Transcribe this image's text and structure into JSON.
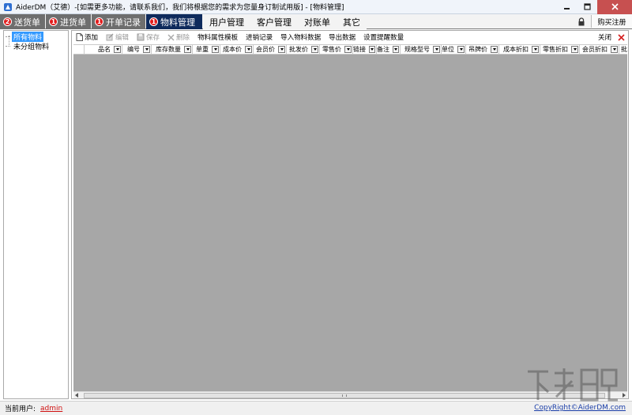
{
  "window": {
    "title": "AiderDM（艾德）-[如需更多功能，请联系我们，我们将根据您的需求为您量身订制试用版] - [物料管理]"
  },
  "tabs": [
    {
      "label": "送货单",
      "badge": "2",
      "style": "dark"
    },
    {
      "label": "进货单",
      "badge": "1",
      "style": "dark"
    },
    {
      "label": "开单记录",
      "badge": "1",
      "style": "dark"
    },
    {
      "label": "物料管理",
      "badge": "1",
      "style": "active"
    },
    {
      "label": "用户管理",
      "style": "plain"
    },
    {
      "label": "客户管理",
      "style": "plain"
    },
    {
      "label": "对账单",
      "style": "plain"
    },
    {
      "label": "其它",
      "style": "plain"
    }
  ],
  "buy_button": "购买注册",
  "tree": {
    "items": [
      {
        "label": "所有物料",
        "selected": true
      },
      {
        "label": "未分组物料",
        "selected": false
      }
    ]
  },
  "toolbar": {
    "add": "添加",
    "edit": "编辑",
    "save": "保存",
    "delete": "删除",
    "attr_template": "物料属性模板",
    "stock_log": "进销记录",
    "import": "导入物料数据",
    "export": "导出数据",
    "reminder": "设置提醒数量",
    "close": "关闭"
  },
  "grid": {
    "columns": [
      "品名",
      "编号",
      "库存数量",
      "单重",
      "成本价",
      "会员价",
      "批发价",
      "零售价",
      "链接",
      "备注",
      "规格型号",
      "单位",
      "吊牌价",
      "成本折扣",
      "零售折扣",
      "会员折扣",
      "批发"
    ]
  },
  "status": {
    "user_label": "当前用户:",
    "user": "admin",
    "copyright": "CopyRight©AiderDM.com"
  },
  "colors": {
    "active_tab": "#0e2a5c",
    "inactive_tab": "#6e6e6e",
    "badge": "#e21b1b",
    "grid_bg": "#a7a7a7",
    "tree_selection": "#3399ff",
    "user_link": "#d01010",
    "copyright_link": "#1a3ea8"
  }
}
